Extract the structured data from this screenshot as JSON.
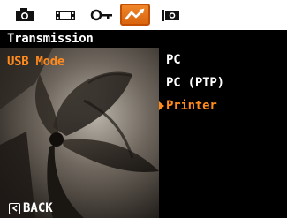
{
  "tabs": [
    {
      "icon": "camera-icon",
      "active": false
    },
    {
      "icon": "movie-icon",
      "active": false
    },
    {
      "icon": "playback-key-icon",
      "active": false
    },
    {
      "icon": "connection-icon",
      "active": true
    },
    {
      "icon": "settings-camera-icon",
      "active": false
    }
  ],
  "header": {
    "title": "Transmission"
  },
  "setting": {
    "label": "USB Mode"
  },
  "options": [
    {
      "label": "PC",
      "selected": false
    },
    {
      "label": "PC (PTP)",
      "selected": false
    },
    {
      "label": "Printer",
      "selected": true
    }
  ],
  "footer": {
    "back_label": "BACK",
    "back_icon": "back-key-icon"
  },
  "colors": {
    "accent": "#ff8a1e",
    "tab_active": "#e8781c",
    "background": "#000000",
    "text": "#ffffff"
  }
}
